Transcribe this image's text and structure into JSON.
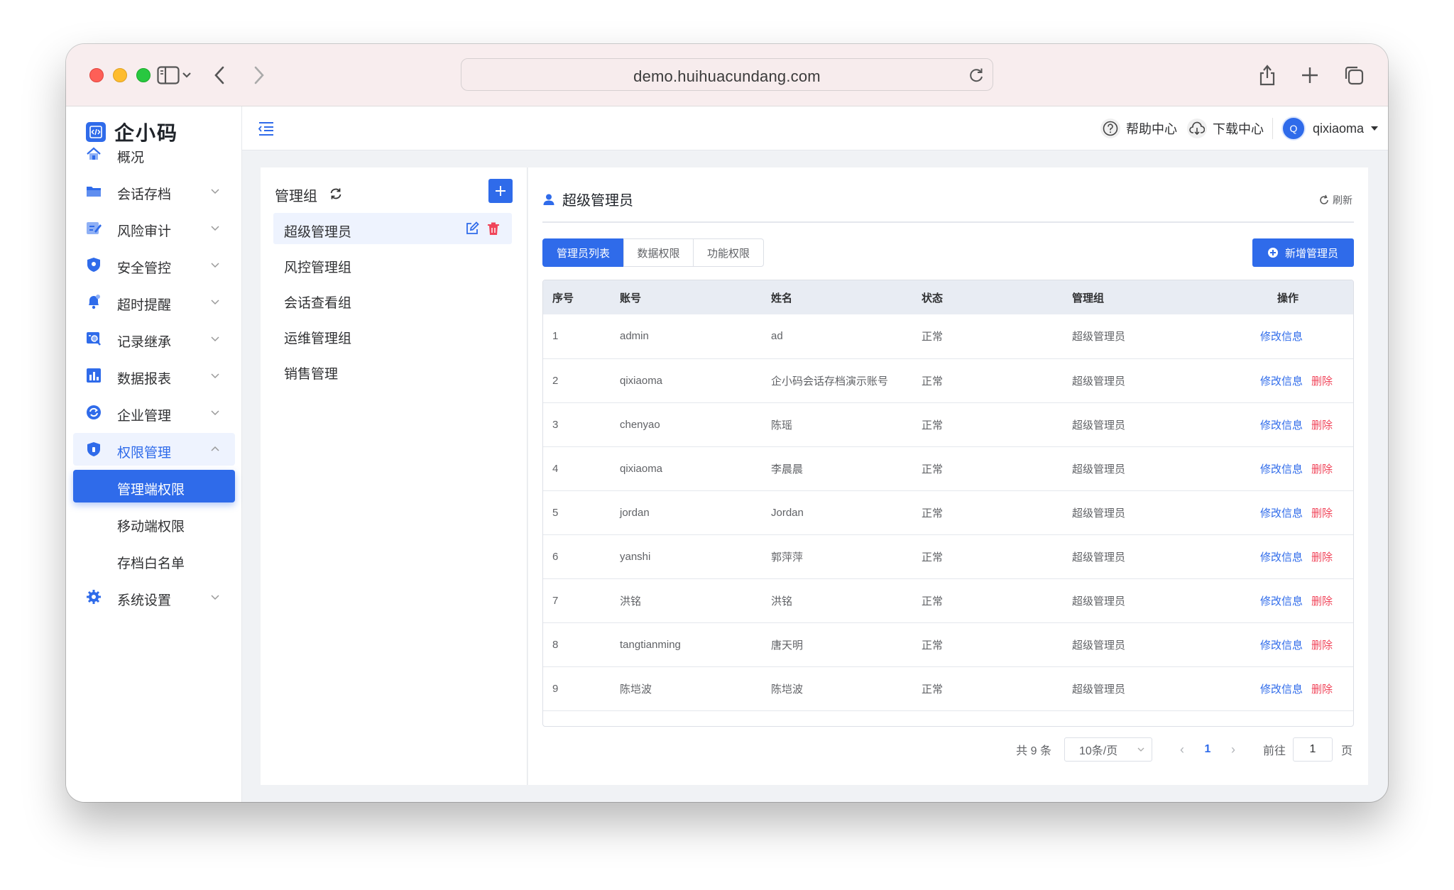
{
  "browser": {
    "url": "demo.huihuacundang.com"
  },
  "logo": {
    "text": "企小码"
  },
  "sidebar": {
    "items": [
      {
        "label": "概况",
        "icon": "home-icon"
      },
      {
        "label": "会话存档",
        "icon": "folder-icon"
      },
      {
        "label": "风险审计",
        "icon": "audit-icon"
      },
      {
        "label": "安全管控",
        "icon": "shield-icon"
      },
      {
        "label": "超时提醒",
        "icon": "bell-icon"
      },
      {
        "label": "记录继承",
        "icon": "record-icon"
      },
      {
        "label": "数据报表",
        "icon": "chart-icon"
      },
      {
        "label": "企业管理",
        "icon": "sync-icon"
      },
      {
        "label": "权限管理",
        "icon": "permission-icon"
      },
      {
        "label": "系统设置",
        "icon": "settings-icon"
      }
    ],
    "submenu": [
      {
        "label": "管理端权限"
      },
      {
        "label": "移动端权限"
      },
      {
        "label": "存档白名单"
      }
    ]
  },
  "header": {
    "help": "帮助中心",
    "download": "下载中心",
    "avatar_letter": "Q",
    "username": "qixiaoma"
  },
  "groups": {
    "title": "管理组",
    "items": [
      "超级管理员",
      "风控管理组",
      "会话查看组",
      "运维管理组",
      "销售管理"
    ]
  },
  "main": {
    "title": "超级管理员",
    "refresh": "刷新",
    "tabs": [
      "管理员列表",
      "数据权限",
      "功能权限"
    ],
    "add_button": "新增管理员",
    "table": {
      "headers": [
        "序号",
        "账号",
        "姓名",
        "状态",
        "管理组",
        "操作"
      ],
      "rows": [
        {
          "no": "1",
          "account": "admin",
          "name": "ad",
          "status": "正常",
          "group": "超级管理员",
          "edit": "修改信息",
          "del": ""
        },
        {
          "no": "2",
          "account": "qixiaoma",
          "name": "企小码会话存档演示账号",
          "status": "正常",
          "group": "超级管理员",
          "edit": "修改信息",
          "del": "删除"
        },
        {
          "no": "3",
          "account": "chenyao",
          "name": "陈瑶",
          "status": "正常",
          "group": "超级管理员",
          "edit": "修改信息",
          "del": "删除"
        },
        {
          "no": "4",
          "account": "qixiaoma",
          "name": "李晨晨",
          "status": "正常",
          "group": "超级管理员",
          "edit": "修改信息",
          "del": "删除"
        },
        {
          "no": "5",
          "account": "jordan",
          "name": "Jordan",
          "status": "正常",
          "group": "超级管理员",
          "edit": "修改信息",
          "del": "删除"
        },
        {
          "no": "6",
          "account": "yanshi",
          "name": "郭萍萍",
          "status": "正常",
          "group": "超级管理员",
          "edit": "修改信息",
          "del": "删除"
        },
        {
          "no": "7",
          "account": "洪铭",
          "name": "洪铭",
          "status": "正常",
          "group": "超级管理员",
          "edit": "修改信息",
          "del": "删除"
        },
        {
          "no": "8",
          "account": "tangtianming",
          "name": "唐天明",
          "status": "正常",
          "group": "超级管理员",
          "edit": "修改信息",
          "del": "删除"
        },
        {
          "no": "9",
          "account": "陈垲波",
          "name": "陈垲波",
          "status": "正常",
          "group": "超级管理员",
          "edit": "修改信息",
          "del": "删除"
        }
      ]
    },
    "pagination": {
      "total": "共 9 条",
      "page_size": "10条/页",
      "current": "1",
      "goto_label": "前往",
      "goto_value": "1",
      "page_suffix": "页"
    }
  },
  "colors": {
    "primary": "#2f6bea",
    "danger": "#f0455a"
  }
}
